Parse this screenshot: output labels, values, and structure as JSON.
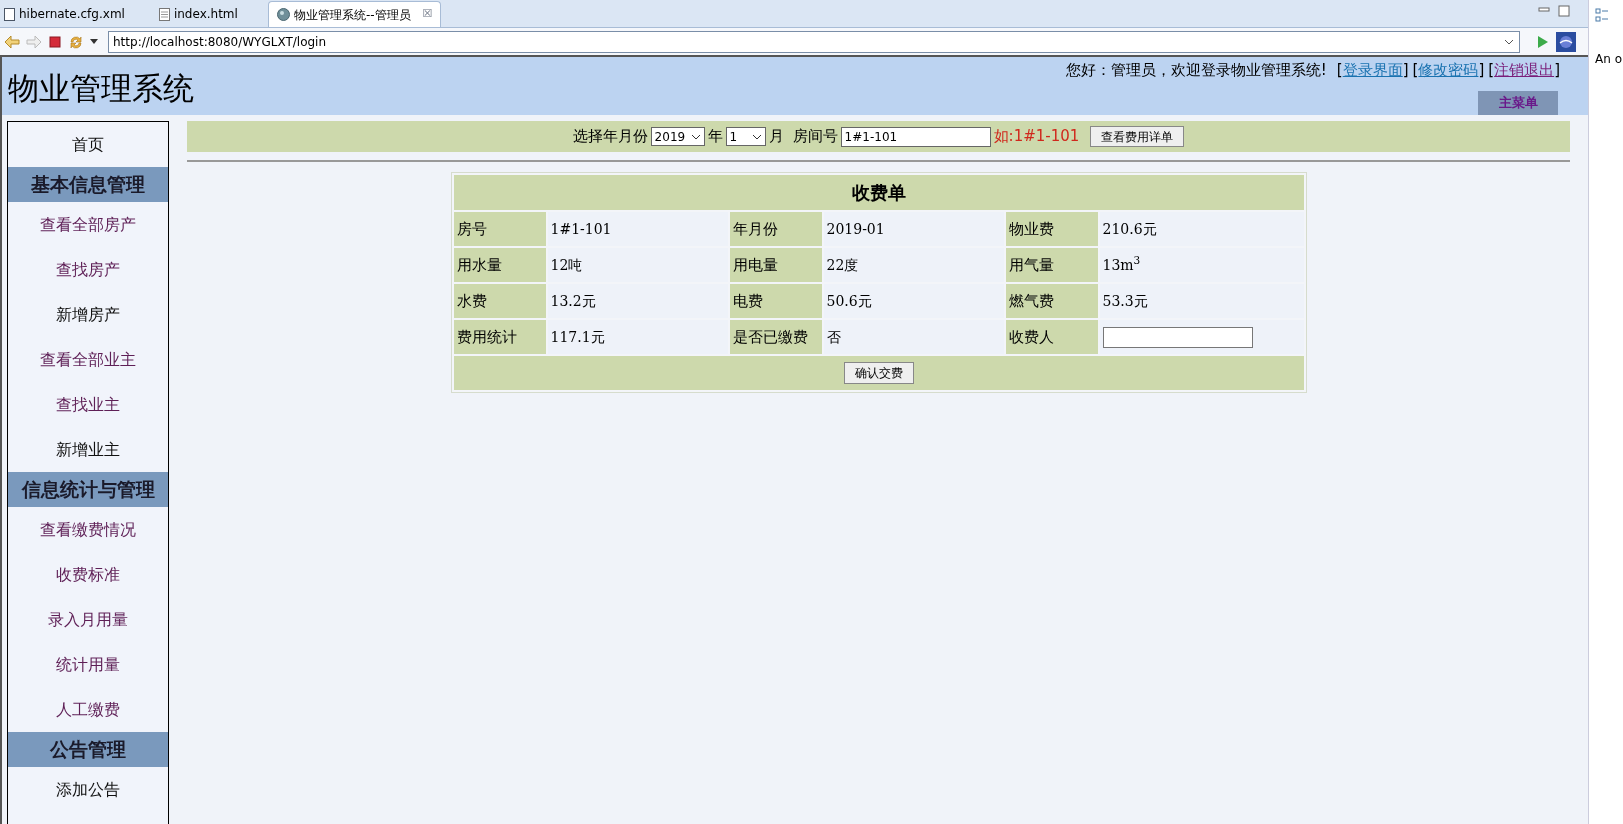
{
  "editor_tabs": [
    {
      "label": "hibernate.cfg.xml",
      "kind": "xml",
      "selected": false
    },
    {
      "label": "index.html",
      "kind": "html",
      "selected": false
    },
    {
      "label": "物业管理系统--管理员",
      "kind": "web",
      "selected": true,
      "close": "☒"
    }
  ],
  "browser": {
    "url": "http://localhost:8080/WYGLXT/login"
  },
  "side_panel": {
    "text": "An o"
  },
  "header": {
    "title": "物业管理系统",
    "greeting": "您好：管理员，欢迎登录物业管理系统!",
    "links": [
      {
        "open": "[",
        "label": "登录界面",
        "close": "]",
        "visited": false
      },
      {
        "open": "[",
        "label": "修改密码",
        "close": "]",
        "visited": false
      },
      {
        "open": "[",
        "label": "注销退出",
        "close": "]",
        "visited": true
      }
    ],
    "menu_button": "主菜单"
  },
  "sidebar": [
    {
      "kind": "item",
      "label": "首页",
      "visited": false
    },
    {
      "kind": "header",
      "label": "基本信息管理"
    },
    {
      "kind": "item",
      "label": "查看全部房产",
      "visited": true
    },
    {
      "kind": "item",
      "label": "查找房产",
      "visited": true
    },
    {
      "kind": "item",
      "label": "新增房产",
      "visited": false
    },
    {
      "kind": "item",
      "label": "查看全部业主",
      "visited": true
    },
    {
      "kind": "item",
      "label": "查找业主",
      "visited": true
    },
    {
      "kind": "item",
      "label": "新增业主",
      "visited": false
    },
    {
      "kind": "header",
      "label": "信息统计与管理"
    },
    {
      "kind": "item",
      "label": "查看缴费情况",
      "visited": true
    },
    {
      "kind": "item",
      "label": "收费标准",
      "visited": true
    },
    {
      "kind": "item",
      "label": "录入月用量",
      "visited": true
    },
    {
      "kind": "item",
      "label": "统计用量",
      "visited": true
    },
    {
      "kind": "item",
      "label": "人工缴费",
      "visited": true
    },
    {
      "kind": "header",
      "label": "公告管理"
    },
    {
      "kind": "item",
      "label": "添加公告",
      "visited": false
    }
  ],
  "filter": {
    "label": "选择年月份",
    "year": "2019",
    "year_unit": "年",
    "month": "1",
    "month_unit": "月",
    "room_label": "房间号",
    "room": "1#1-101",
    "hint": "如:1#1-101",
    "button": "查看费用详单"
  },
  "bill": {
    "title": "收费单",
    "rows": [
      [
        {
          "label": "房号",
          "value": "1#1-101"
        },
        {
          "label": "年月份",
          "value": "2019-01"
        },
        {
          "label": "物业费",
          "value": "210.6元"
        }
      ],
      [
        {
          "label": "用水量",
          "value": "12吨"
        },
        {
          "label": "用电量",
          "value": "22度"
        },
        {
          "label": "用气量",
          "value": "13m$^{3}$"
        }
      ],
      [
        {
          "label": "水费",
          "value": "13.2元"
        },
        {
          "label": "电费",
          "value": "50.6元"
        },
        {
          "label": "燃气费",
          "value": "53.3元"
        }
      ],
      [
        {
          "label": "费用统计",
          "value": "117.1元"
        },
        {
          "label": "是否已缴费",
          "value": "否"
        },
        {
          "label": "收费人",
          "kind": "input"
        }
      ]
    ],
    "button": "确认交费"
  }
}
